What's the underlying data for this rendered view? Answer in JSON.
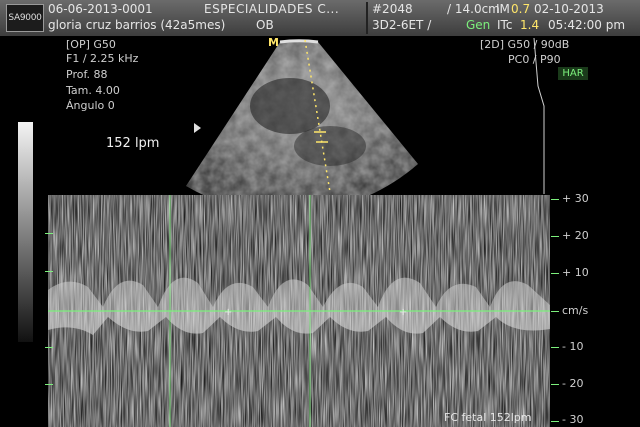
{
  "header": {
    "logo": "SA9000",
    "patient_id": "06-06-2013-0001",
    "patient_name": "gloria cruz barrios (42a5mes)",
    "exam_type": "OB",
    "institution": "ESPECIALIDADES C...",
    "frame_no": "#2048",
    "depth": "/ 14.0cm",
    "mi_label": "IM",
    "mi_value": "0.7",
    "date": "02-10-2013",
    "probe": "3D2-6ET /",
    "gen_label": "Gen",
    "itc_label": "ITc",
    "itc_value": "1.4",
    "time": "05:42:00 pm"
  },
  "left_params": {
    "op": "[OP]  G50",
    "freq": "F1 / 2.25 kHz",
    "prof": "Prof.       88",
    "tam": "Tam.      4.00",
    "angulo": "Ángulo  0"
  },
  "right_params": {
    "mode": "[2D] G50 / 90dB",
    "pc": "PC0 / P90",
    "har": "HAR"
  },
  "m_marker": "M",
  "heart_rate": "152  lpm",
  "doppler": {
    "scale_labels": [
      "+ 30",
      "+ 20",
      "+ 10",
      "cm/s",
      "- 10",
      "- 20",
      "- 30"
    ],
    "footer": "FC fetal 152lpm"
  },
  "colors": {
    "marker_yellow": "#ffe66a",
    "accent_green": "#7cf07c",
    "header_gray": "#5a5a5a"
  }
}
